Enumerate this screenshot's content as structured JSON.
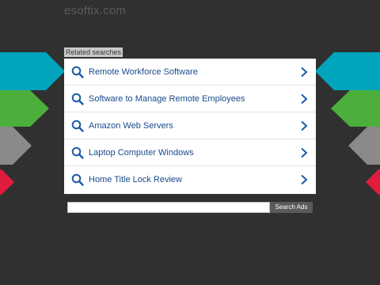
{
  "site": {
    "logo": "esoftix.com"
  },
  "related": {
    "label": "Related searches",
    "items": [
      {
        "label": "Remote Workforce Software"
      },
      {
        "label": "Software to Manage Remote Employees"
      },
      {
        "label": "Amazon Web Servers"
      },
      {
        "label": "Laptop Computer Windows"
      },
      {
        "label": "Home Title Lock Review"
      }
    ]
  },
  "search": {
    "placeholder": "",
    "button_label": "Search Ads"
  },
  "colors": {
    "background": "#303030",
    "link": "#1b4a8c",
    "icon": "#1f5aa6",
    "chevron_cyan": "#00a4bd",
    "chevron_green": "#4caf3c",
    "chevron_gray": "#8a8a8a",
    "chevron_red": "#e01b3c"
  },
  "icons": {
    "row_leading": "search-icon",
    "row_trailing": "chevron-right-icon"
  }
}
